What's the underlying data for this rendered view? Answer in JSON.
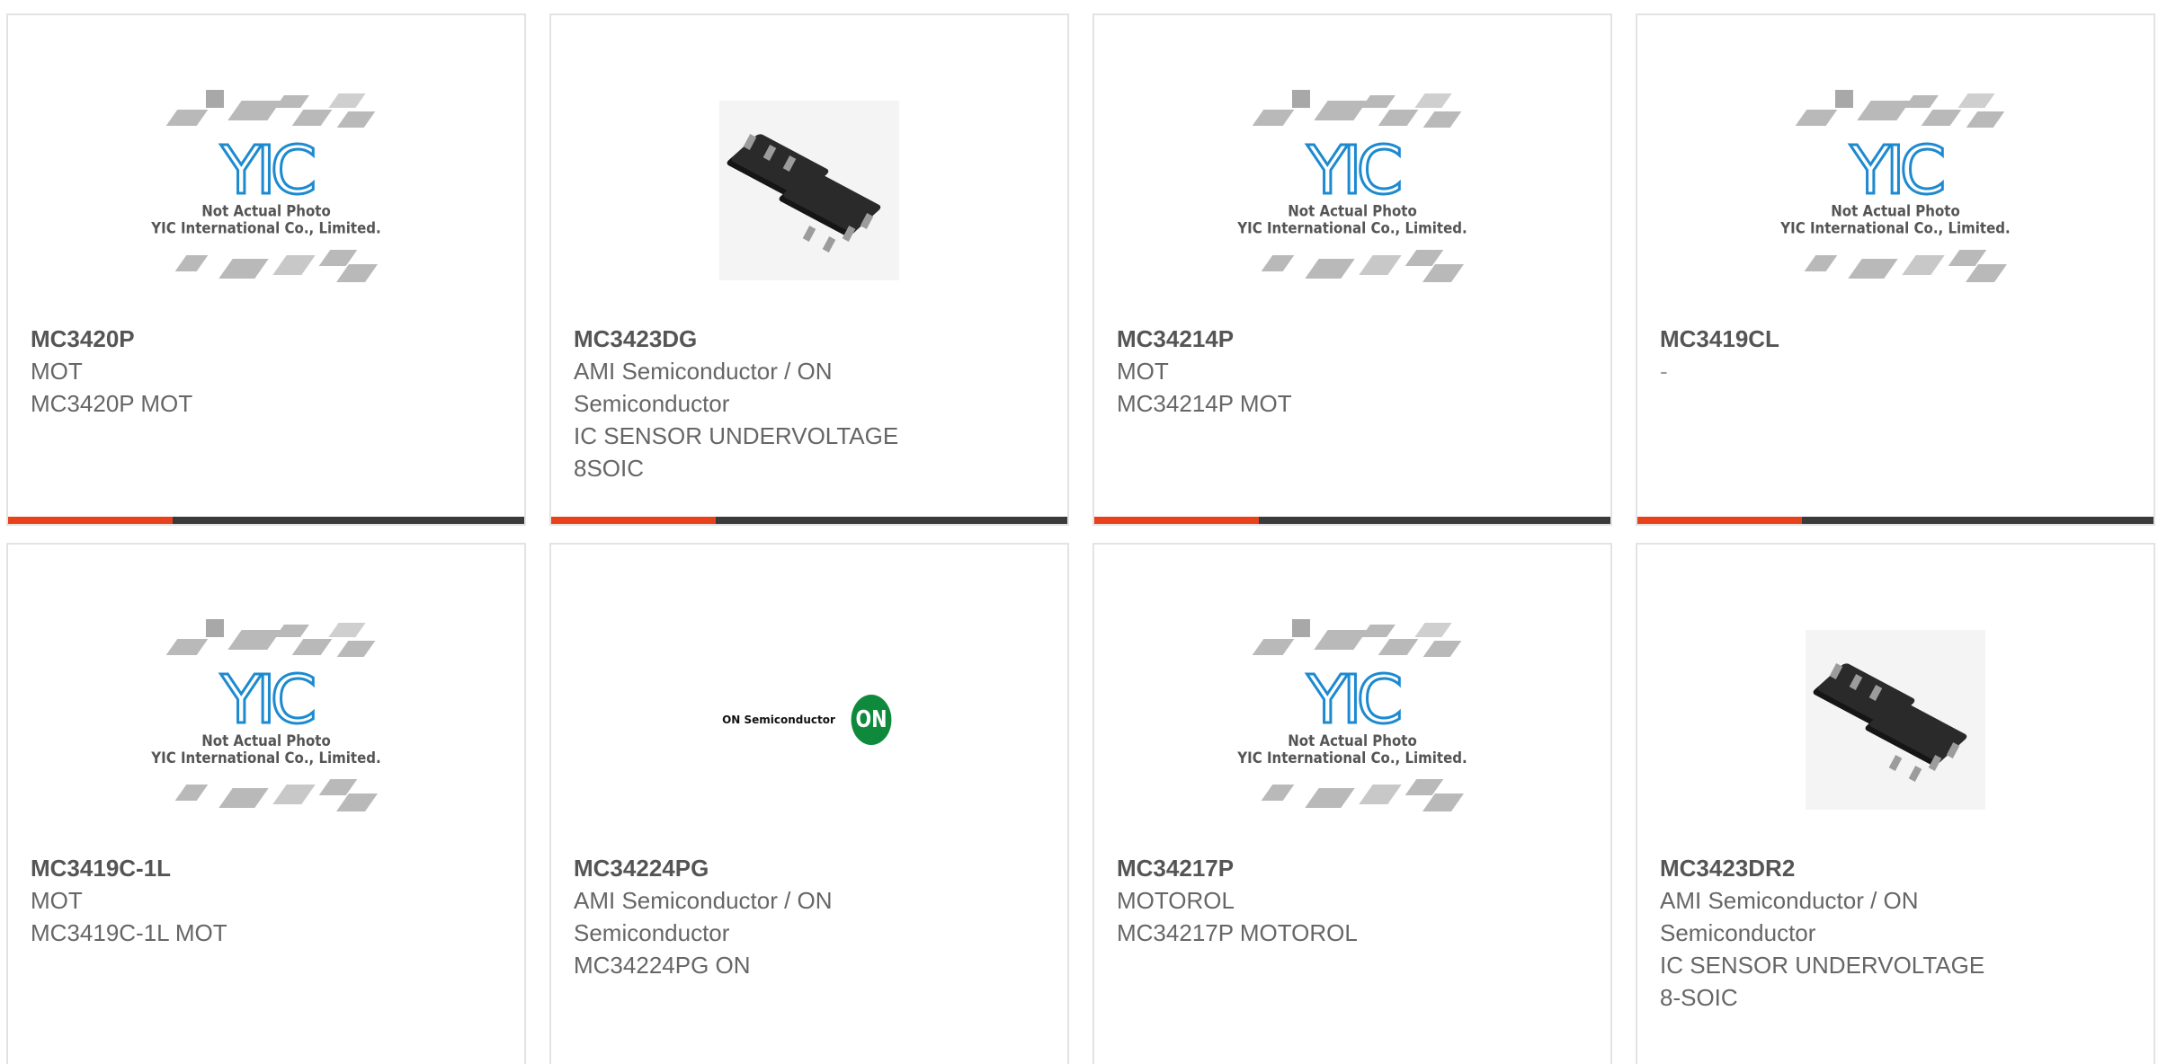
{
  "placeholder_image": {
    "caption_line1": "Not Actual Photo",
    "caption_line2": "YIC International Co., Limited.",
    "logo_text": "YIC",
    "icon": "yic-placeholder-icon"
  },
  "on_logo": {
    "wordmark": "ON Semiconductor",
    "badge": "ON"
  },
  "colors": {
    "accent": "#e8411b",
    "bar": "#3a3a3a",
    "yic_blue": "#1d8ad0",
    "on_green": "#0f8a3c"
  },
  "products": [
    {
      "part": "MC3420P",
      "lines": [
        "MOT",
        "MC3420P MOT"
      ],
      "image": "yic-placeholder"
    },
    {
      "part": "MC3423DG",
      "lines": [
        "AMI Semiconductor / ON",
        "Semiconductor",
        "IC SENSOR UNDERVOLTAGE",
        "8SOIC"
      ],
      "image": "soic-photo"
    },
    {
      "part": "MC34214P",
      "lines": [
        "MOT",
        "MC34214P MOT"
      ],
      "image": "yic-placeholder"
    },
    {
      "part": "MC3419CL",
      "lines": [
        "-"
      ],
      "image": "yic-placeholder"
    },
    {
      "part": "MC3419C-1L",
      "lines": [
        "MOT",
        "MC3419C-1L MOT"
      ],
      "image": "yic-placeholder"
    },
    {
      "part": "MC34224PG",
      "lines": [
        "AMI Semiconductor / ON",
        "Semiconductor",
        "MC34224PG ON"
      ],
      "image": "on-logo"
    },
    {
      "part": "MC34217P",
      "lines": [
        "MOTOROL",
        "MC34217P MOTOROL"
      ],
      "image": "yic-placeholder"
    },
    {
      "part": "MC3423DR2",
      "lines": [
        "AMI Semiconductor / ON",
        "Semiconductor",
        "IC SENSOR UNDERVOLTAGE",
        "8-SOIC"
      ],
      "image": "soic-photo"
    }
  ]
}
